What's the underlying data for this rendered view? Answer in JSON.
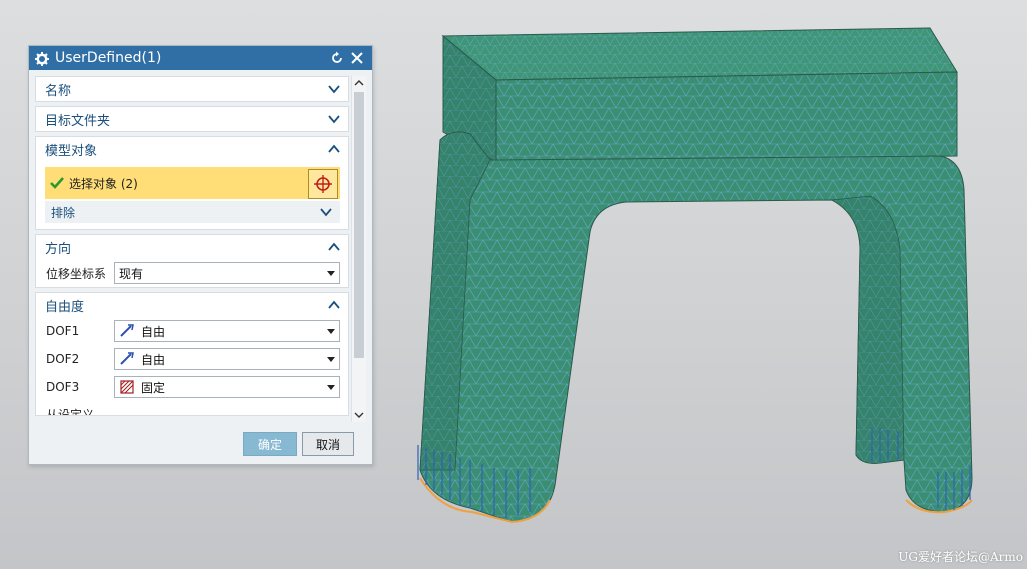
{
  "dialog": {
    "title": "UserDefined(1)",
    "sections": {
      "name": {
        "label": "名称"
      },
      "target_folder": {
        "label": "目标文件夹"
      },
      "model_objects": {
        "label": "模型对象",
        "select_label": "选择对象 (2)",
        "exclude_label": "排除"
      },
      "direction": {
        "label": "方向",
        "coord_label": "位移坐标系",
        "coord_value": "现有"
      },
      "dof": {
        "label": "自由度",
        "rows": [
          {
            "label": "DOF1",
            "value": "自由",
            "icon": "free-dof-icon"
          },
          {
            "label": "DOF2",
            "value": "自由",
            "icon": "free-dof-icon"
          },
          {
            "label": "DOF3",
            "value": "固定",
            "icon": "fixed-dof-icon"
          }
        ],
        "partial_label": "从设定义"
      }
    },
    "ok_label": "确定",
    "cancel_label": "取消"
  },
  "watermark": "UG爱好者论坛@Armo",
  "colors": {
    "titlebar": "#2f6fa6",
    "mesh_fill": "#3a8f73",
    "mesh_line": "#6aa4c8",
    "selection": "#ffdd77",
    "constraint": "#2e62b8",
    "edge_highlight": "#f0a040"
  }
}
